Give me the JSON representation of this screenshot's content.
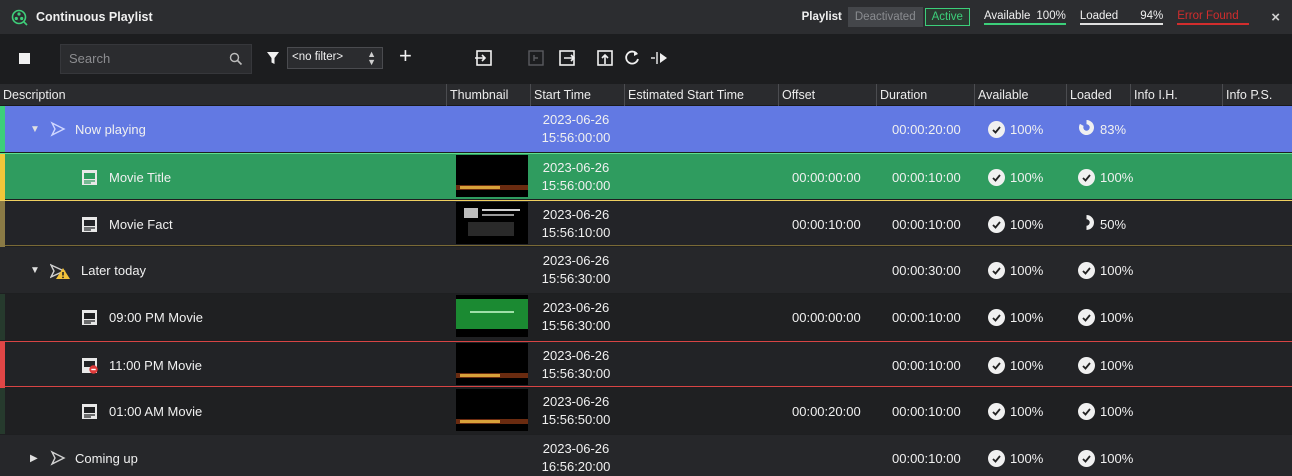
{
  "window": {
    "title": "Continuous Playlist",
    "playlist_label": "Playlist",
    "deactivated_label": "Deactivated",
    "active_label": "Active",
    "available_label": "Available",
    "available_value": "100%",
    "loaded_label": "Loaded",
    "loaded_value": "94%",
    "error_label": "Error Found",
    "close_label": "×",
    "colors": {
      "accent_green": "#3ccf7a",
      "error_red": "#d22d2d",
      "now_playing_bg": "#6078e0",
      "playing_item_bg": "#2f9b5e"
    }
  },
  "toolbar": {
    "search_placeholder": "Search",
    "filter_value": "<no filter>",
    "icons": [
      "stop-icon",
      "search-icon",
      "filter-icon",
      "add-icon",
      "insert-icon",
      "disabled-insert-icon",
      "export-icon",
      "upload-icon",
      "refresh-icon",
      "split-play-icon"
    ]
  },
  "columns": {
    "description": "Description",
    "thumbnail": "Thumbnail",
    "start_time": "Start Time",
    "estimated_start_time": "Estimated Start Time",
    "offset": "Offset",
    "duration": "Duration",
    "available": "Available",
    "loaded": "Loaded",
    "info_ih": "Info I.H.",
    "info_ps": "Info P.S."
  },
  "rows": [
    {
      "label": "Now playing",
      "type": "group",
      "expanded": true,
      "date": "2023-06-26",
      "time": "15:56:00:00",
      "offset": "",
      "duration": "00:00:20:00",
      "available": "100%",
      "loaded": "83%",
      "loaded_fraction": 0.83
    },
    {
      "label": "Movie Title",
      "type": "item",
      "date": "2023-06-26",
      "time": "15:56:00:00",
      "offset": "00:00:00:00",
      "duration": "00:00:10:00",
      "available": "100%",
      "loaded": "100%"
    },
    {
      "label": "Movie Fact",
      "type": "item",
      "date": "2023-06-26",
      "time": "15:56:10:00",
      "offset": "00:00:10:00",
      "duration": "00:00:10:00",
      "available": "100%",
      "loaded": "50%",
      "loaded_fraction": 0.5
    },
    {
      "label": "Later today",
      "type": "group",
      "expanded": true,
      "date": "2023-06-26",
      "time": "15:56:30:00",
      "offset": "",
      "duration": "00:00:30:00",
      "available": "100%",
      "loaded": "100%"
    },
    {
      "label": "09:00 PM Movie",
      "type": "item",
      "date": "2023-06-26",
      "time": "15:56:30:00",
      "offset": "00:00:00:00",
      "duration": "00:00:10:00",
      "available": "100%",
      "loaded": "100%"
    },
    {
      "label": "11:00 PM Movie",
      "type": "item",
      "date": "2023-06-26",
      "time": "15:56:30:00",
      "offset": "",
      "duration": "00:00:10:00",
      "available": "100%",
      "loaded": "100%"
    },
    {
      "label": "01:00 AM Movie",
      "type": "item",
      "date": "2023-06-26",
      "time": "15:56:50:00",
      "offset": "00:00:20:00",
      "duration": "00:00:10:00",
      "available": "100%",
      "loaded": "100%"
    },
    {
      "label": "Coming up",
      "type": "group",
      "expanded": false,
      "date": "2023-06-26",
      "time": "16:56:20:00",
      "offset": "",
      "duration": "00:00:10:00",
      "available": "100%",
      "loaded": "100%"
    }
  ]
}
